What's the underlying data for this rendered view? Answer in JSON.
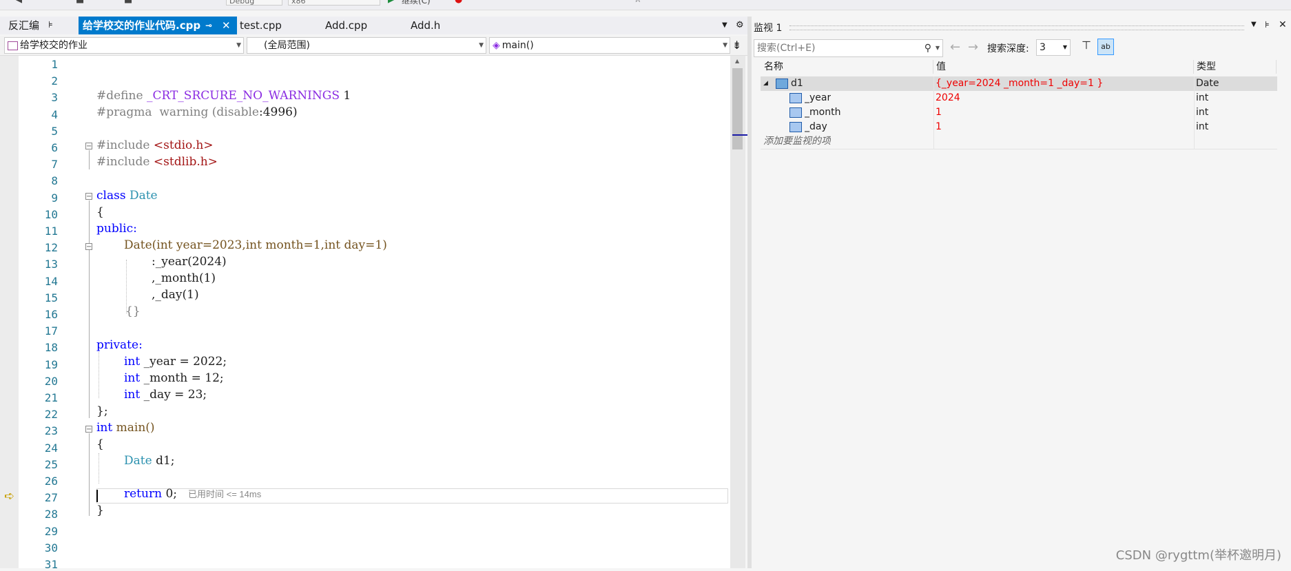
{
  "toolbar": {
    "config": "Debug",
    "platform": "x86",
    "run_label": "继续(C)"
  },
  "tabs": [
    {
      "label": "反汇编",
      "active": false
    },
    {
      "label": "给学校交的作业代码.cpp",
      "active": true
    },
    {
      "label": "test.cpp",
      "active": false
    },
    {
      "label": "Add.cpp",
      "active": false
    },
    {
      "label": "Add.h",
      "active": false
    }
  ],
  "nav": {
    "project": "给学校交的作业",
    "scope": "(全局范围)",
    "member": "main()"
  },
  "editor": {
    "line_numbers": [
      "1",
      "2",
      "3",
      "4",
      "5",
      "6",
      "7",
      "8",
      "9",
      "10",
      "11",
      "12",
      "13",
      "14",
      "15",
      "16",
      "17",
      "18",
      "19",
      "20",
      "21",
      "22",
      "23",
      "24",
      "25",
      "26",
      "27",
      "28",
      "29",
      "30",
      "31"
    ],
    "lines": {
      "l3a": "#define ",
      "l3b": "_CRT_SRCURE_NO_WARNINGS",
      "l3c": " 1",
      "l4a": "#pragma  warning ",
      "l4b": "(disable",
      "l4c": ":4996)",
      "l6a": "#include ",
      "l6b": "<stdio.h>",
      "l7a": "#include ",
      "l7b": "<stdlib.h>",
      "l9a": "class ",
      "l9b": "Date",
      "l10": "{",
      "l11": "public:",
      "l12": "Date(int year=2023,int month=1,int day=1)",
      "l13": ":_year(2024)",
      "l14": ",_month(1)",
      "l15": ",_day(1)",
      "l16": "{}",
      "l18": "private:",
      "l19a": "int",
      "l19b": " _year = 2022;",
      "l20a": "int",
      "l20b": " _month = 12;",
      "l21a": "int",
      "l21b": " _day = 23;",
      "l22": "};",
      "l23a": "int",
      "l23b": " main()",
      "l24": "{",
      "l25a": "Date",
      "l25b": " d1;",
      "l27a": "return",
      "l27b": " 0;",
      "l27hint": "已用时间 <= 14ms",
      "l28": "}"
    }
  },
  "watch": {
    "title": "监视 1",
    "search_placeholder": "搜索(Ctrl+E)",
    "depth_label": "搜索深度:",
    "depth_value": "3",
    "columns": [
      "名称",
      "值",
      "类型"
    ],
    "rows": [
      {
        "name": "d1",
        "value": "{_year=2024 _month=1 _day=1 }",
        "type": "Date"
      },
      {
        "name": "_year",
        "value": "2024",
        "type": "int"
      },
      {
        "name": "_month",
        "value": "1",
        "type": "int"
      },
      {
        "name": "_day",
        "value": "1",
        "type": "int"
      }
    ],
    "add_item": "添加要监视的项"
  },
  "watermark": "CSDN @rygttm(举杯邀明月)"
}
